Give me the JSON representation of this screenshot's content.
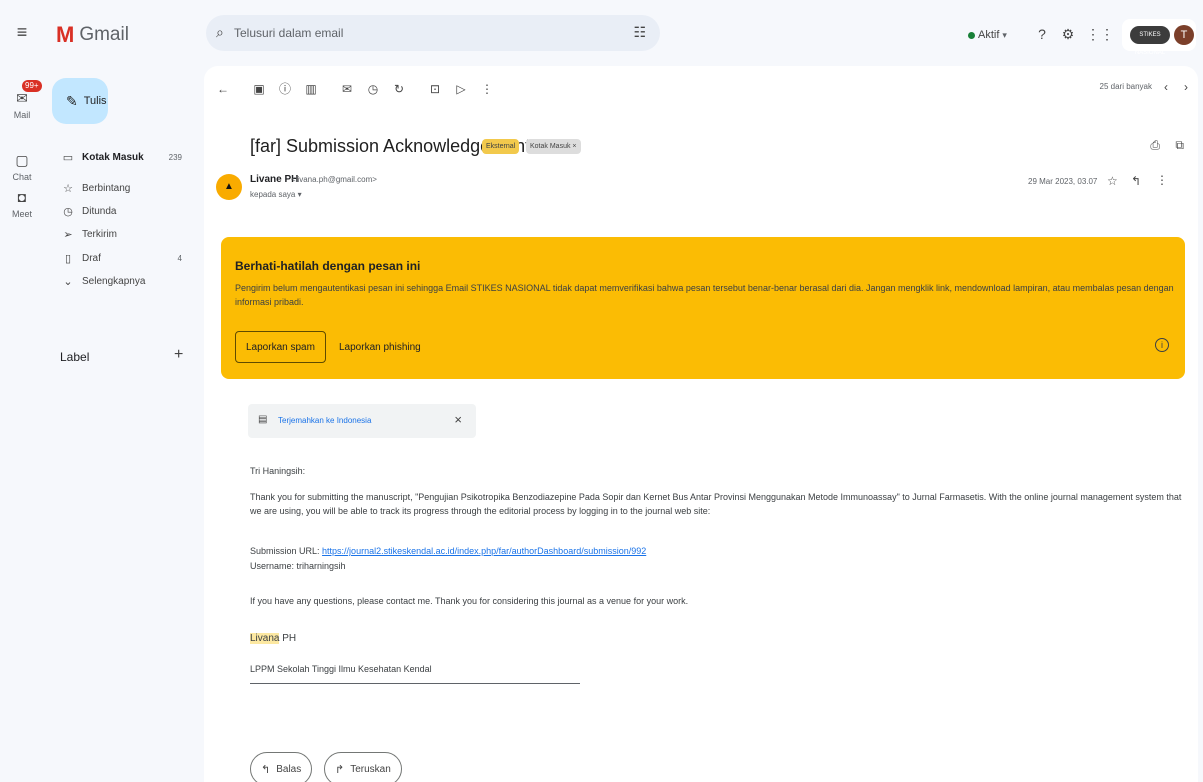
{
  "app": {
    "name": "Gmail"
  },
  "rail": {
    "mail_label": "Mail",
    "mail_badge": "99+",
    "chat_label": "Chat",
    "meet_label": "Meet"
  },
  "search": {
    "placeholder": "Telusuri dalam email"
  },
  "status": {
    "label": "Aktif",
    "color": "#188038"
  },
  "account": {
    "org_text": "STIKES NASIONAL",
    "avatar_letter": "T"
  },
  "compose": {
    "label": "Tulis"
  },
  "nav": [
    {
      "label": "Kotak Masuk",
      "count": "239",
      "icon": "inbox-icon"
    },
    {
      "label": "Berbintang",
      "count": "",
      "icon": "star-icon"
    },
    {
      "label": "Ditunda",
      "count": "",
      "icon": "clock-icon"
    },
    {
      "label": "Terkirim",
      "count": "",
      "icon": "send-icon"
    },
    {
      "label": "Draf",
      "count": "4",
      "icon": "draft-icon"
    },
    {
      "label": "Selengkapnya",
      "count": "",
      "icon": "chevron-down-icon"
    }
  ],
  "labels": {
    "title": "Label"
  },
  "toolbar": {
    "pager": "25 dari banyak"
  },
  "email": {
    "subject": "[far] Submission Acknowledgement",
    "badge_external": "Eksternal",
    "badge_inbox": "Kotak Masuk ×",
    "sender_name": "Livane PH",
    "sender_email": "<livana.ph@gmail.com>",
    "sender_initial": "▲",
    "recipient": "kepada saya ▾",
    "date": "29 Mar 2023, 03.07",
    "warning": {
      "title": "Berhati-hatilah dengan pesan ini",
      "body": "Pengirim belum mengautentikasi pesan ini sehingga Email STIKES NASIONAL tidak dapat memverifikasi bahwa pesan tersebut benar-benar berasal dari dia. Jangan mengklik link, mendownload lampiran, atau membalas pesan dengan informasi pribadi.",
      "spam_button": "Laporkan spam",
      "phishing_button": "Laporkan phishing",
      "color": "#fbbc04"
    },
    "translate": {
      "link": "Terjemahkan ke Indonesia"
    },
    "body": {
      "greeting": "Tri Haningsih:",
      "p1": "Thank you for submitting the manuscript, \"Pengujian Psikotropika Benzodiazepine Pada Sopir dan Kernet Bus Antar Provinsi Menggunakan Metode Immunoassay\" to Jurnal Farmasetis. With the online journal management system that we are using, you will be able to track its progress through the editorial process by logging in to the journal web site:",
      "url_label": "Submission URL:",
      "url": "https://journal2.stikeskendal.ac.id/index.php/far/authorDashboard/submission/992",
      "username_line": "Username: triharningsih",
      "p2": "If you have any questions, please contact me. Thank you for considering this journal as a venue for your work.",
      "sig_name_hl": "Livana",
      "sig_name_rest": " PH",
      "sig_org": "LPPM Sekolah Tinggi Ilmu Kesehatan Kendal"
    },
    "reply_button": "Balas",
    "forward_button": "Teruskan"
  }
}
